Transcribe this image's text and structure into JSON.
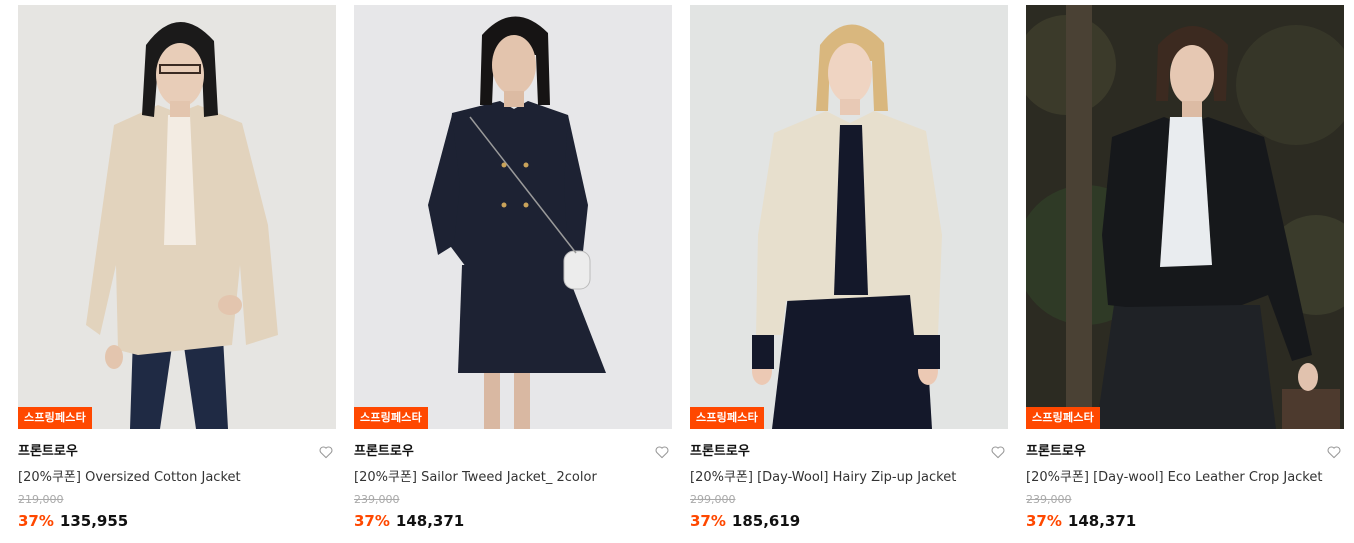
{
  "products": [
    {
      "badge": "스프링페스타",
      "brand": "프론트로우",
      "name": "[20%쿠폰] Oversized Cotton Jacket",
      "original_price": "219,000",
      "discount": "37%",
      "sale_price": "135,955",
      "photo": "woman-in-beige-blazer-and-jeans",
      "bg_color": "#e6e5e2",
      "garment_color": "#e2d3bd"
    },
    {
      "badge": "스프링페스타",
      "brand": "프론트로우",
      "name": "[20%쿠폰] Sailor Tweed Jacket_ 2color",
      "original_price": "239,000",
      "discount": "37%",
      "sale_price": "148,371",
      "photo": "woman-in-navy-tweed-jacket-and-skirt",
      "bg_color": "#e7e7e9",
      "garment_color": "#1d2233"
    },
    {
      "badge": "스프링페스타",
      "brand": "프론트로우",
      "name": "[20%쿠폰] [Day-Wool] Hairy Zip-up Jacket",
      "original_price": "299,000",
      "discount": "37%",
      "sale_price": "185,619",
      "photo": "woman-in-cream-wool-jacket-and-navy-dress",
      "bg_color": "#e2e4e3",
      "garment_color": "#e7dfcd"
    },
    {
      "badge": "스프링페스타",
      "brand": "프론트로우",
      "name": "[20%쿠폰] [Day-wool] Eco Leather Crop Jacket",
      "original_price": "239,000",
      "discount": "37%",
      "sale_price": "148,371",
      "photo": "woman-in-black-leather-jacket-outdoors",
      "bg_color": "#2c2b22",
      "garment_color": "#16181b"
    }
  ],
  "colors": {
    "accent": "#ff4800",
    "text": "#111111",
    "muted": "#aaaaaa"
  },
  "icons": {
    "wishlist": "heart-outline-icon"
  }
}
